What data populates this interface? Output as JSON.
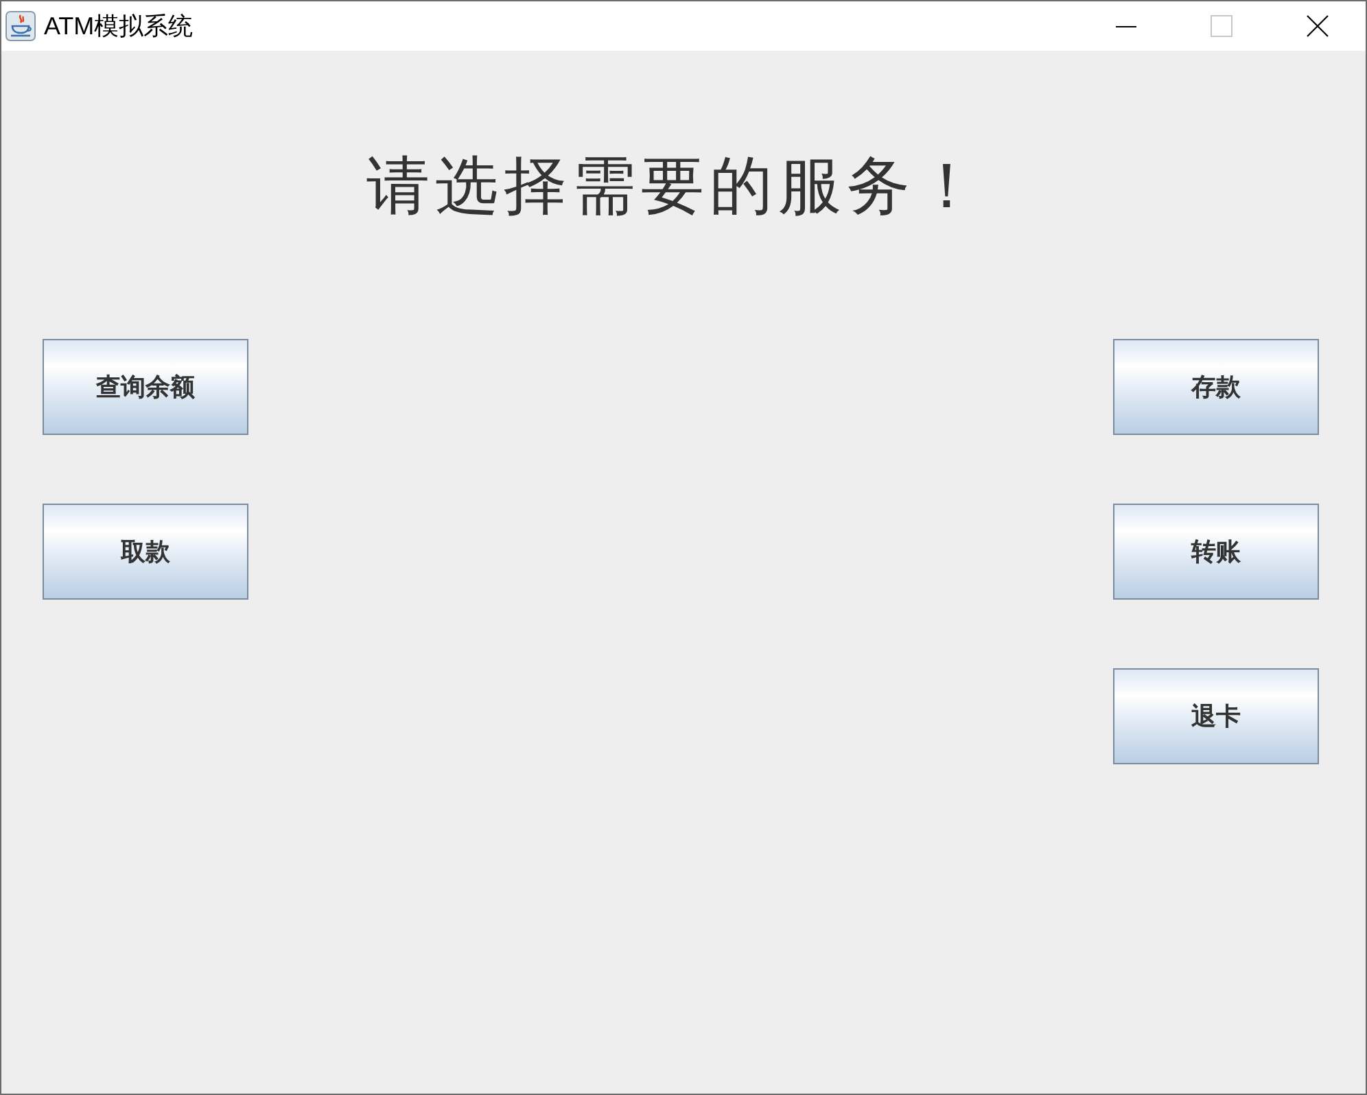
{
  "window": {
    "title": "ATM模拟系统",
    "controls": [
      {
        "kind": "minimize",
        "disabled": false
      },
      {
        "kind": "maximize",
        "disabled": true
      },
      {
        "kind": "close",
        "disabled": false
      }
    ]
  },
  "heading": "请选择需要的服务！",
  "buttons_left": [
    "查询余额",
    "取款"
  ],
  "buttons_right": [
    "存款",
    "转账",
    "退卡"
  ]
}
